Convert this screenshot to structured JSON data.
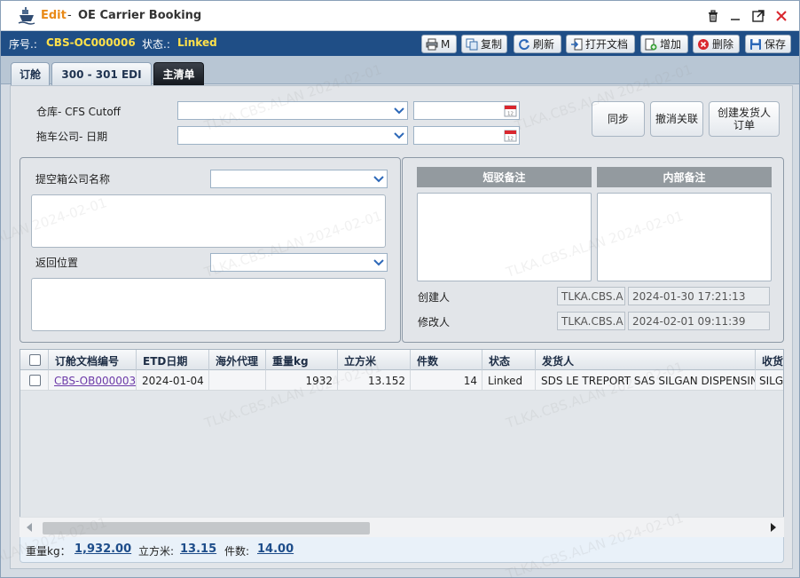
{
  "window": {
    "mode": "Edit",
    "separator": "-",
    "title": "OE Carrier Booking"
  },
  "infobar": {
    "serial_label": "序号.:",
    "serial_value": "CBS-OC000006",
    "status_label": "状态.:",
    "status_value": "Linked"
  },
  "toolbar": {
    "print": "M",
    "copy": "复制",
    "refresh": "刷新",
    "open_doc": "打开文档",
    "add": "增加",
    "delete": "删除",
    "save": "保存"
  },
  "tabs": [
    {
      "label": "订舱",
      "active": false
    },
    {
      "label": "300 - 301 EDI",
      "active": false
    },
    {
      "label": "主清单",
      "active": true
    }
  ],
  "form": {
    "warehouse_label": "仓库- CFS Cutoff",
    "trucking_label": "拖车公司- 日期",
    "sync_button": "同步",
    "unlink_button": "撤消关联",
    "create_shipper_line1": "创建发货人",
    "create_shipper_line2": "订单",
    "pickup_label": "提空箱公司名称",
    "return_label": "返回位置",
    "short_remark_label": "短驳备注",
    "internal_remark_label": "内部备注",
    "creator_label": "创建人",
    "creator_value": "TLKA.CBS.A",
    "created_at": "2024-01-30 17:21:13",
    "modifier_label": "修改人",
    "modifier_value": "TLKA.CBS.A",
    "modified_at": "2024-02-01 09:11:39"
  },
  "grid": {
    "columns": [
      "订舱文档编号",
      "ETD日期",
      "海外代理",
      "重量kg",
      "立方米",
      "件数",
      "状态",
      "发货人",
      "收货"
    ],
    "rows": [
      {
        "doc_no": "CBS-OB000003",
        "etd": "2024-01-04",
        "agent": "",
        "weight": "1932",
        "cbm": "13.152",
        "pieces": "14",
        "status": "Linked",
        "shipper": "SDS LE TREPORT SAS SILGAN DISPENSING",
        "consignee": "SILGA"
      }
    ]
  },
  "totals": {
    "weight_label": "重量kg：",
    "weight_value": "1,932.00",
    "cbm_label": "立方米:",
    "cbm_value": "13.15",
    "pieces_label": "件数:",
    "pieces_value": "14.00"
  },
  "watermark": "TLKA.CBS.ALAN 2024-02-01",
  "colors": {
    "header_bar": "#1f4e86",
    "status_yellow": "#ffe14a",
    "edit_orange": "#e98a17",
    "link_purple": "#6c3aa8",
    "close_red": "#d9272e"
  }
}
